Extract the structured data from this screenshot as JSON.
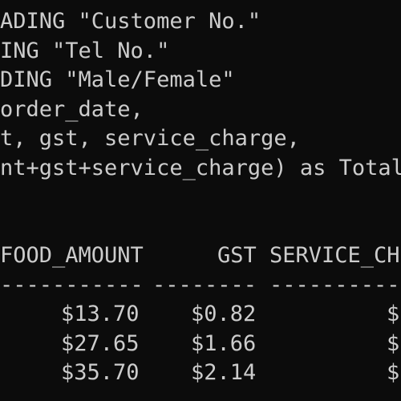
{
  "console": {
    "sql_lines": [
      "ADING \"Customer No.\"",
      "ING \"Tel No.\"",
      "DING \"Male/Female\"",
      "order_date,",
      "t, gst, service_charge,",
      "nt+gst+service_charge) as Total,"
    ],
    "result": {
      "headers": {
        "food_amount": "FOOD_AMOUNT",
        "gst": "GST",
        "service_charge": "SERVICE_CH"
      },
      "separators": {
        "food_amount": "-----------",
        "gst": "--------",
        "service_charge": "----------"
      },
      "rows": [
        {
          "food_amount": "$13.70",
          "gst": "$0.82",
          "service_charge": "$"
        },
        {
          "food_amount": "$27.65",
          "gst": "$1.66",
          "service_charge": "$"
        },
        {
          "food_amount": "$35.70",
          "gst": "$2.14",
          "service_charge": "$"
        }
      ]
    }
  },
  "colors": {
    "background": "#0c0c0c",
    "text": "#cccccc"
  }
}
